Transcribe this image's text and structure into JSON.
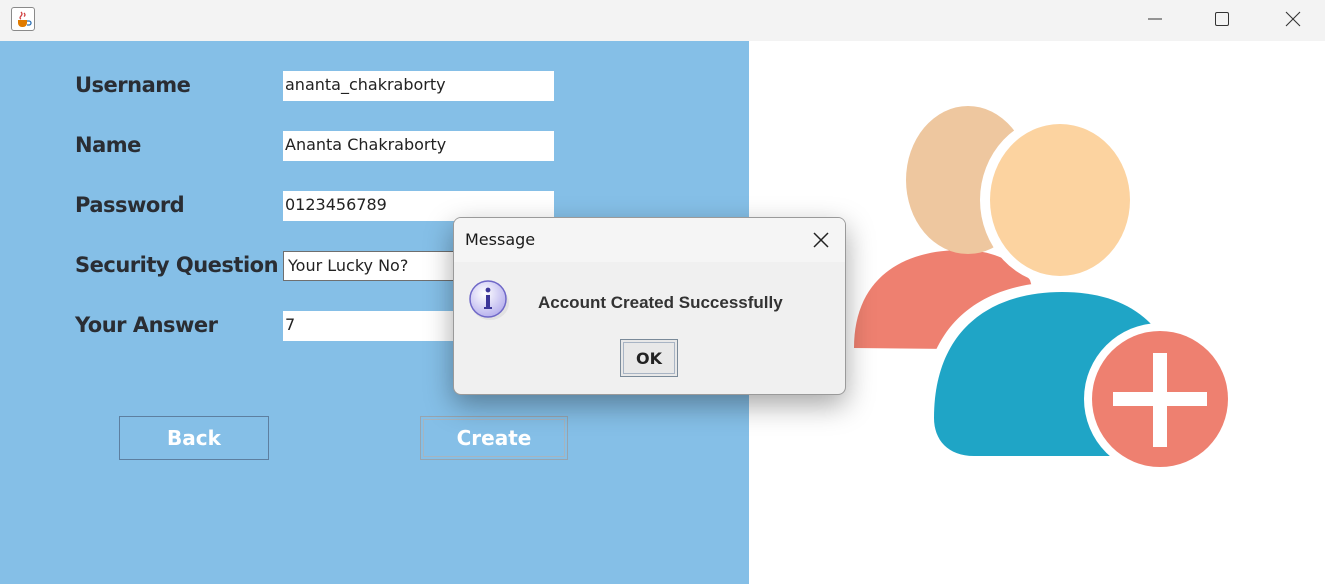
{
  "window": {
    "title": "",
    "icon": "java-coffee-cup-icon",
    "controls": [
      "minimize-icon",
      "maximize-icon",
      "close-icon"
    ]
  },
  "form": {
    "username_label": "Username",
    "username_value": "ananta_chakraborty",
    "name_label": "Name",
    "name_value": "Ananta Chakraborty",
    "password_label": "Password",
    "password_value": "0123456789",
    "security_question_label": "Security Question",
    "security_question_value": "Your Lucky No?",
    "answer_label": "Your Answer",
    "answer_value": "7",
    "back_label": "Back",
    "create_label": "Create"
  },
  "dialog": {
    "title": "Message",
    "icon": "information-icon",
    "message": "Account Created Successfully",
    "ok_label": "OK"
  },
  "illustration": {
    "icon": "add-user-icon"
  },
  "colors": {
    "panel_background": "#85bfe7",
    "label_text": "#2a2d33",
    "user_back_head": "#eec79f",
    "user_back_body": "#ee8070",
    "user_front_head": "#fcd3a0",
    "user_front_body": "#1fa5c6",
    "plus_badge": "#ee8070"
  }
}
